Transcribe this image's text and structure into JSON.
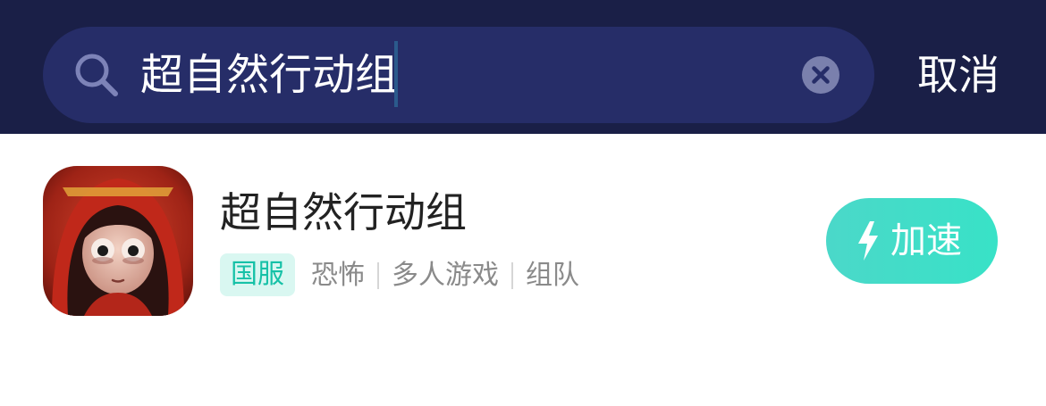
{
  "search": {
    "query": "超自然行动组",
    "icon": "search-icon",
    "clear_icon": "clear-icon"
  },
  "header": {
    "cancel_label": "取消"
  },
  "result": {
    "title": "超自然行动组",
    "region_badge": "国服",
    "tags": [
      "恐怖",
      "多人游戏",
      "组队"
    ],
    "boost_label": "加速",
    "boost_icon": "lightning-bolt-icon"
  },
  "colors": {
    "header_bg": "#1a1f47",
    "search_bg": "#262d68",
    "accent": "#3ddfc8",
    "badge_text": "#16c1a7",
    "badge_bg": "#d9f7f1"
  }
}
